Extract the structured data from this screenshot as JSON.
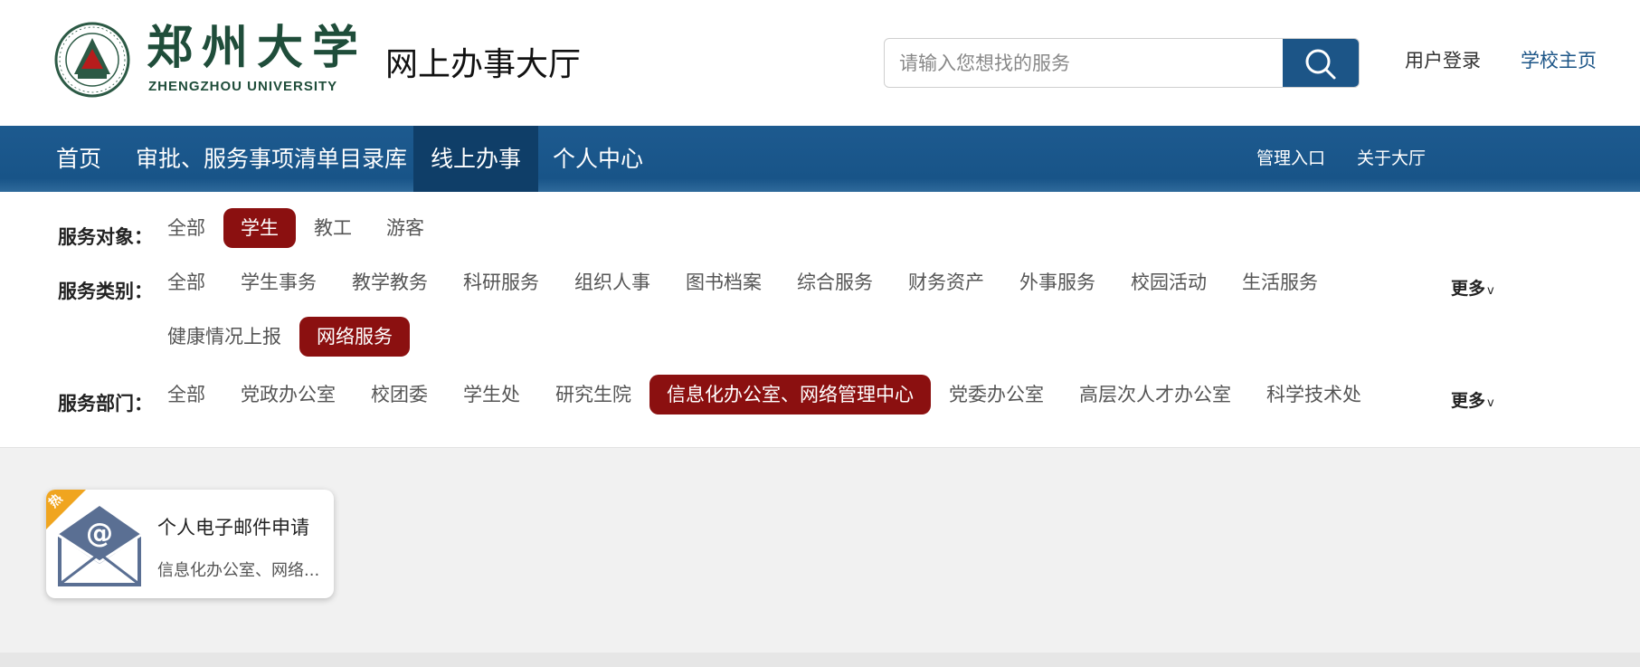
{
  "header": {
    "logo_cn": "郑州大学",
    "logo_en": "ZHENGZHOU UNIVERSITY",
    "site_title": "网上办事大厅",
    "search_placeholder": "请输入您想找的服务",
    "search_value": "",
    "login": "用户登录",
    "homepage": "学校主页"
  },
  "nav": {
    "items": [
      "首页",
      "审批、服务事项清单目录库",
      "线上办事",
      "个人中心"
    ],
    "active_index": 2,
    "right": [
      "管理入口",
      "关于大厅"
    ]
  },
  "filters": {
    "target": {
      "label": "服务对象：",
      "options": [
        "全部",
        "学生",
        "教工",
        "游客"
      ],
      "selected": "学生"
    },
    "category": {
      "label": "服务类别：",
      "options": [
        "全部",
        "学生事务",
        "教学教务",
        "科研服务",
        "组织人事",
        "图书档案",
        "综合服务",
        "财务资产",
        "外事服务",
        "校园活动",
        "生活服务",
        "健康情况上报",
        "网络服务"
      ],
      "selected": "网络服务",
      "more": "更多"
    },
    "department": {
      "label": "服务部门：",
      "options": [
        "全部",
        "党政办公室",
        "校团委",
        "学生处",
        "研究生院",
        "信息化办公室、网络管理中心",
        "党委办公室",
        "高层次人才办公室",
        "科学技术处"
      ],
      "selected": "信息化办公室、网络管理中心",
      "more": "更多"
    }
  },
  "services": [
    {
      "title": "个人电子邮件申请",
      "department": "信息化办公室、网络...",
      "badge": "热",
      "icon": "envelope-at-icon"
    }
  ],
  "colors": {
    "brand_blue": "#1c5587",
    "nav_active": "#0f3e68",
    "selected_chip": "#8b1010",
    "hot_badge": "#f0a51f"
  }
}
